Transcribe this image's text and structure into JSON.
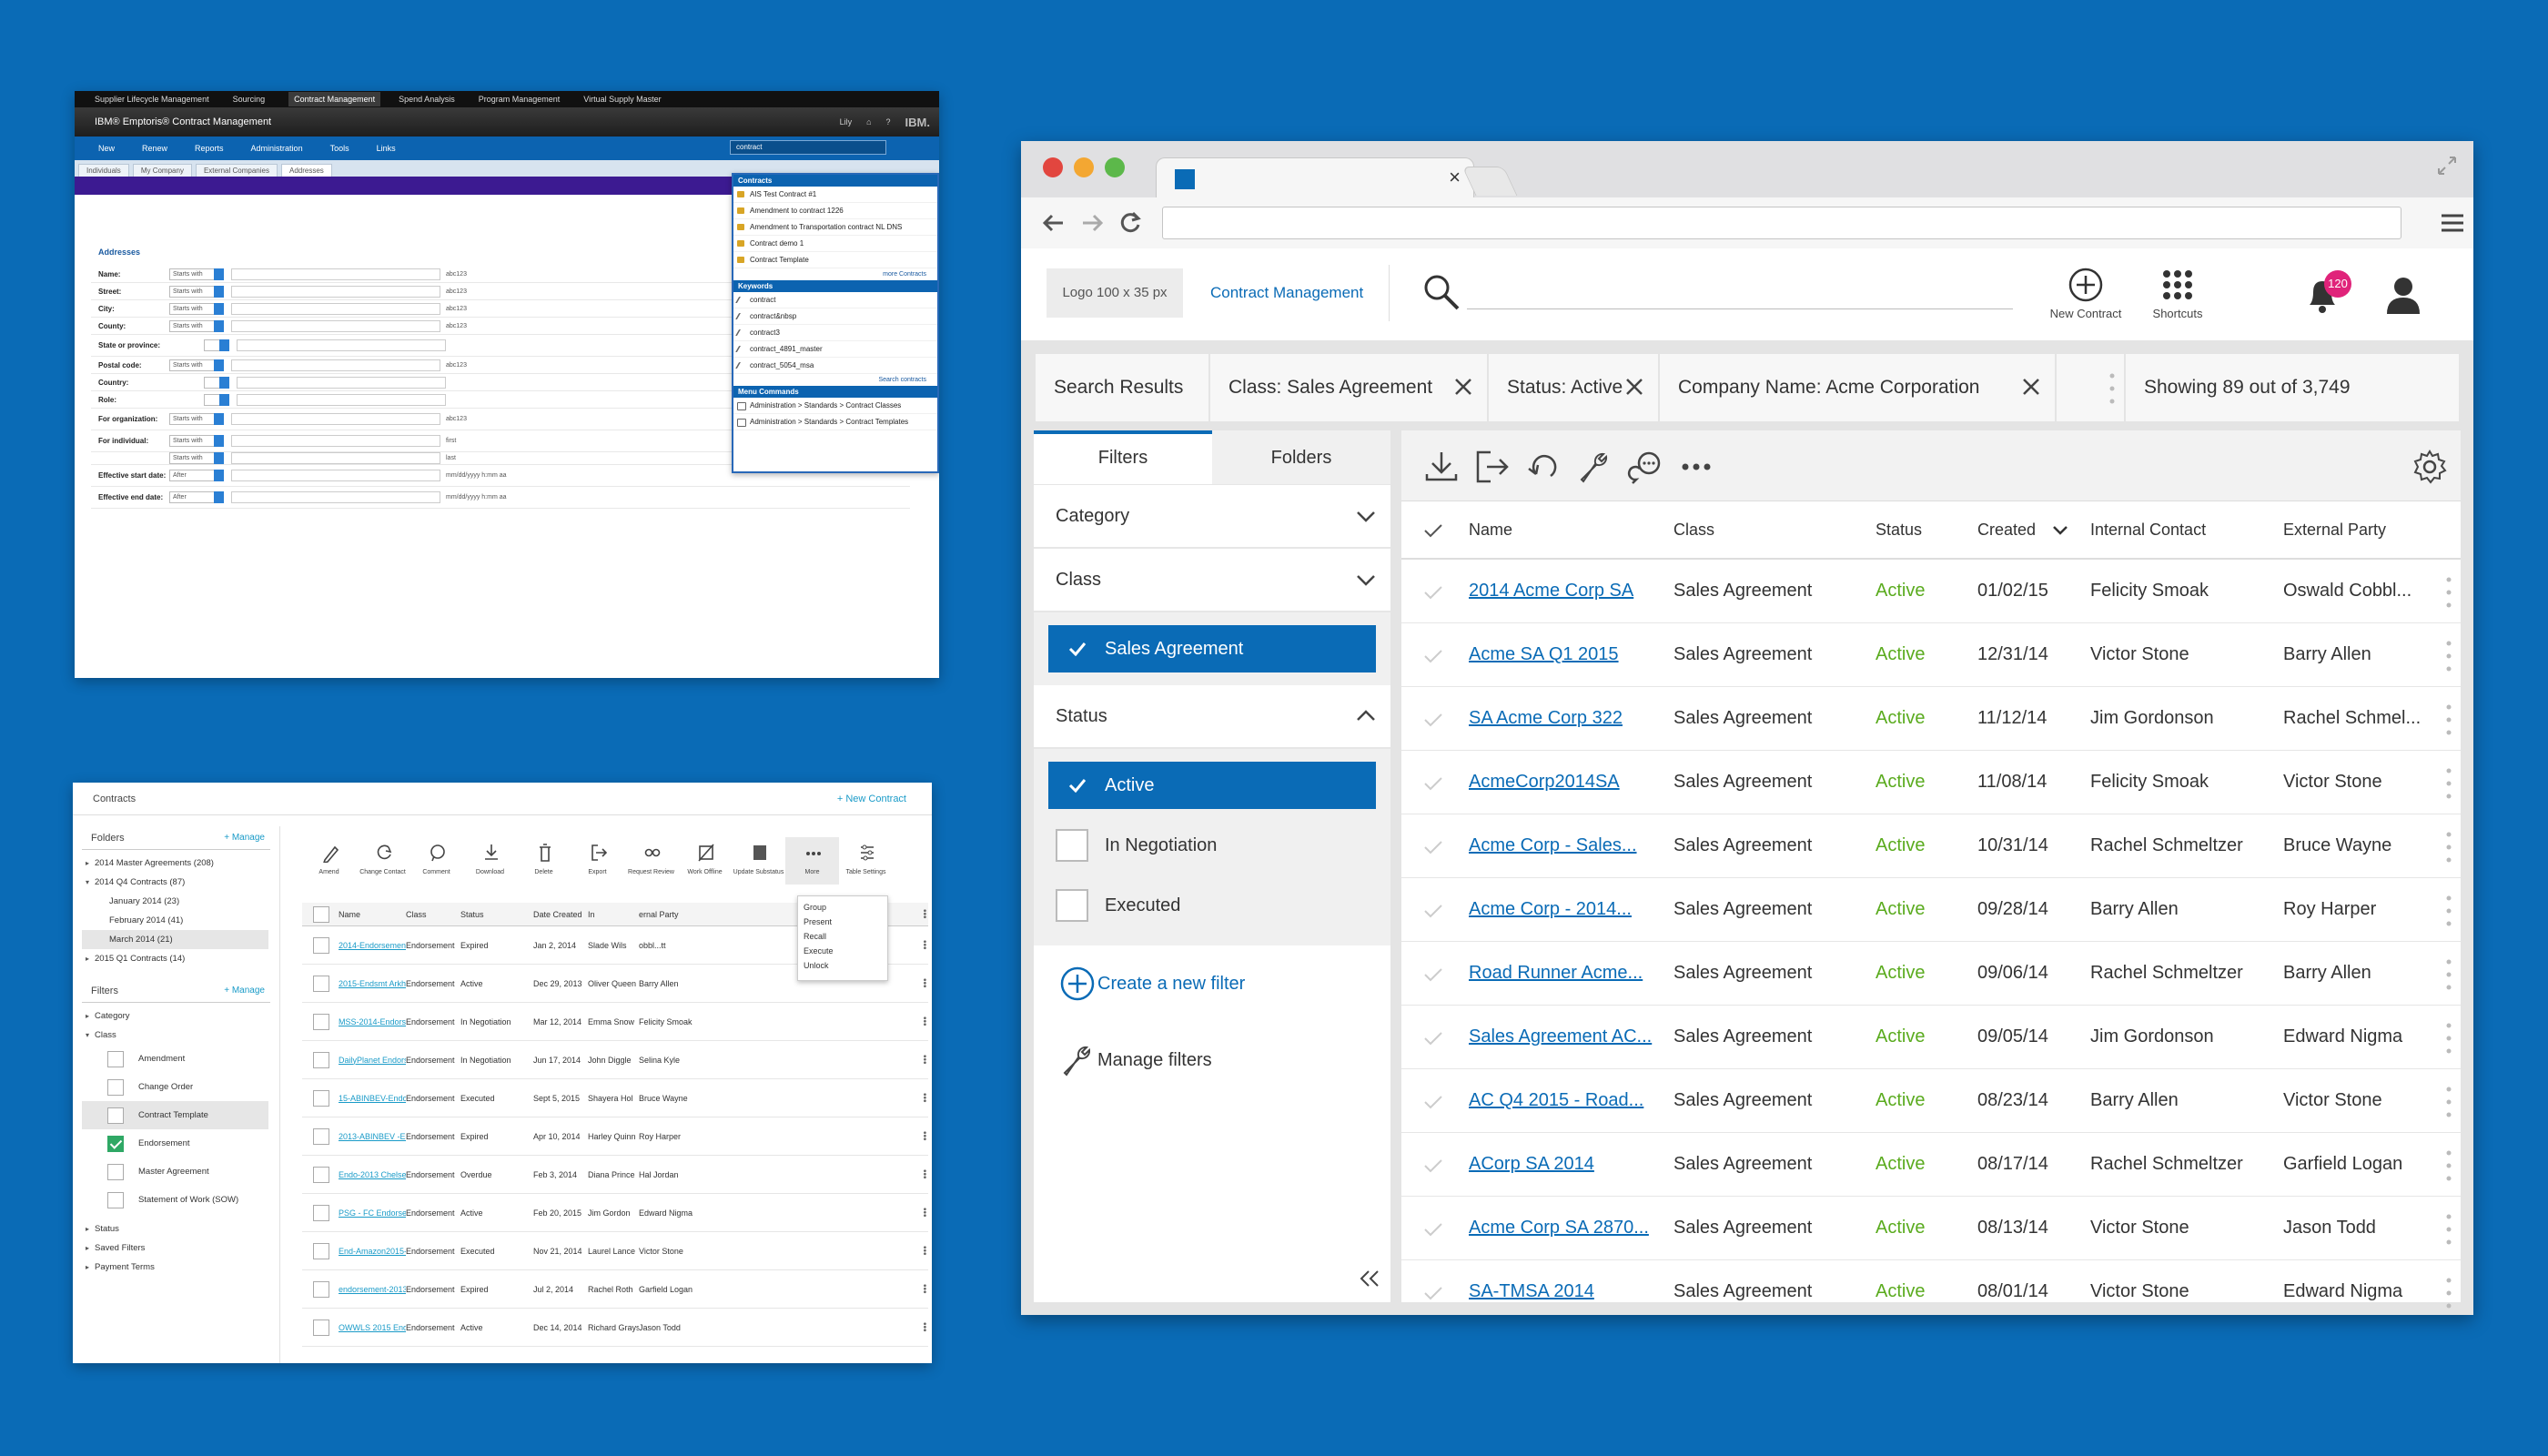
{
  "panel1": {
    "topnav": [
      "Supplier Lifecycle Management",
      "Sourcing",
      "Contract Management",
      "Spend Analysis",
      "Program Management",
      "Virtual Supply Master"
    ],
    "topnav_selected": 2,
    "app_title": "IBM® Emptoris® Contract Management",
    "user": "Lily",
    "brand": "IBM.",
    "menu": [
      "New",
      "Renew",
      "Reports",
      "Administration",
      "Tools",
      "Links"
    ],
    "search_value": "contract",
    "tabs": [
      "Individuals",
      "My Company",
      "External Companies",
      "Addresses"
    ],
    "tab_selected": 3,
    "section": "Addresses",
    "fields": [
      {
        "label": "Name:",
        "op": "Starts with",
        "hint": "abc123"
      },
      {
        "label": "Street:",
        "op": "Starts with",
        "hint": "abc123"
      },
      {
        "label": "City:",
        "op": "Starts with",
        "hint": "abc123"
      },
      {
        "label": "County:",
        "op": "Starts with",
        "hint": "abc123"
      },
      {
        "label": "State or province:",
        "op": "",
        "hint": ""
      },
      {
        "label": "Postal code:",
        "op": "Starts with",
        "hint": "abc123"
      },
      {
        "label": "Country:",
        "op": "",
        "hint": ""
      },
      {
        "label": "Role:",
        "op": "",
        "hint": ""
      },
      {
        "label": "For organization:",
        "op": "Starts with",
        "hint": "abc123"
      },
      {
        "label": "For individual:",
        "op": "Starts with",
        "hint": "first"
      },
      {
        "label": "",
        "op": "Starts with",
        "hint": "last"
      },
      {
        "label": "Effective start date:",
        "op": "After",
        "hint": "mm/dd/yyyy   h:mm aa"
      },
      {
        "label": "Effective end date:",
        "op": "After",
        "hint": "mm/dd/yyyy   h:mm aa"
      }
    ],
    "dropdown": {
      "contracts_title": "Contracts",
      "contracts": [
        "AIS Test Contract #1",
        "Amendment to contract 1226",
        "Amendment to Transportation contract NL DNS",
        "Contract demo 1",
        "Contract Template"
      ],
      "more_contracts": "more Contracts",
      "keywords_title": "Keywords",
      "keywords": [
        "contract",
        "contract&nbsp",
        "contract3",
        "contract_4891_master",
        "contract_5054_msa"
      ],
      "search_contracts": "Search contracts",
      "menu_title": "Menu Commands",
      "menu": [
        "Administration > Standards > Contract Classes",
        "Administration > Standards > Contract Templates"
      ]
    }
  },
  "panel2": {
    "title": "Contracts",
    "new_contract": "+ New Contract",
    "folders_title": "Folders",
    "manage": "+ Manage",
    "folders": [
      {
        "label": "2014 Master Agreements (208)",
        "level": 1,
        "arrow": "▸"
      },
      {
        "label": "2014 Q4 Contracts (87)",
        "level": 1,
        "arrow": "▾"
      },
      {
        "label": "January 2014 (23)",
        "level": 2,
        "arrow": ""
      },
      {
        "label": "February 2014 (41)",
        "level": 2,
        "arrow": ""
      },
      {
        "label": "March 2014 (21)",
        "level": 2,
        "arrow": "",
        "hl": true
      },
      {
        "label": "2015 Q1 Contracts (14)",
        "level": 1,
        "arrow": "▸"
      }
    ],
    "filters_title": "Filters",
    "category": "Category",
    "class": "Class",
    "classes": [
      {
        "label": "Amendment",
        "on": false
      },
      {
        "label": "Change Order",
        "on": false
      },
      {
        "label": "Contract Template",
        "on": false,
        "hl": true
      },
      {
        "label": "Endorsement",
        "on": true
      },
      {
        "label": "Master Agreement",
        "on": false
      },
      {
        "label": "Statement of Work (SOW)",
        "on": false
      }
    ],
    "bottom": [
      "Status",
      "Saved Filters",
      "Payment Terms"
    ],
    "toolbar": [
      "Amend",
      "Change Contact",
      "Comment",
      "Download",
      "Delete",
      "Export",
      "Request Review",
      "Work Offline",
      "Update Substatus",
      "More",
      "Table Settings"
    ],
    "more_menu": [
      "Group",
      "Present",
      "Recall",
      "Execute",
      "Unlock"
    ],
    "columns": [
      "Name",
      "Class",
      "Status",
      "Date Created",
      "In",
      "ernal Party"
    ],
    "rows": [
      [
        "2014-EndorsementPS...",
        "Endorsement",
        "Expired",
        "Jan 2, 2014",
        "Slade Wils",
        "obbl...tt"
      ],
      [
        "2015-Endsmt Arkham",
        "Endorsement",
        "Active",
        "Dec 29, 2013",
        "Oliver Queen",
        "Barry Allen"
      ],
      [
        "MSS-2014-Endorseme...",
        "Endorsement",
        "In Negotiation",
        "Mar 12, 2014",
        "Emma Snow",
        "Felicity Smoak"
      ],
      [
        "DailyPlanet Endorsem...",
        "Endorsement",
        "In Negotiation",
        "Jun 17, 2014",
        "John Diggle",
        "Selina Kyle"
      ],
      [
        "15-ABINBEV-Endo...",
        "Endorsement",
        "Executed",
        "Sept 5, 2015",
        "Shayera Hol",
        "Bruce Wayne"
      ],
      [
        "2013-ABINBEV -Endo...",
        "Endorsement",
        "Expired",
        "Apr 10, 2014",
        "Harley Quinn",
        "Roy Harper"
      ],
      [
        "Endo-2013 Chelsea R...",
        "Endorsement",
        "Overdue",
        "Feb 3, 2014",
        "Diana Prince",
        "Hal Jordan"
      ],
      [
        "PSG - FC Endorsement...",
        "Endorsement",
        "Active",
        "Feb 20, 2015",
        "Jim Gordon",
        "Edward Nigma"
      ],
      [
        "End-Amazon2015-R...",
        "Endorsement",
        "Executed",
        "Nov 21, 2014",
        "Laurel Lance",
        "Victor Stone"
      ],
      [
        "endorsement-2013 RTC",
        "Endorsement",
        "Expired",
        "Jul 2, 2014",
        "Rachel Roth",
        "Garfield Logan"
      ],
      [
        "OWWLS 2015 End...",
        "Endorsement",
        "Active",
        "Dec 14, 2014",
        "Richard Grayson",
        "Jason Todd"
      ]
    ]
  },
  "panel3": {
    "logo": "Logo 100 x 35 px",
    "app_link": "Contract Management",
    "new_contract": "New Contract",
    "shortcuts": "Shortcuts",
    "notifications": "120",
    "chips": [
      {
        "label": "Search Results",
        "close": false
      },
      {
        "label": "Class: Sales Agreement",
        "close": true
      },
      {
        "label": "Status: Active",
        "close": true
      },
      {
        "label": "Company Name: Acme Corporation",
        "close": true
      },
      {
        "label": "",
        "close": false,
        "more": true
      },
      {
        "label": "Showing 89 out of 3,749",
        "close": false
      }
    ],
    "tabs": [
      "Filters",
      "Folders"
    ],
    "category": "Category",
    "class": "Class",
    "class_selected": "Sales Agreement",
    "status": "Status",
    "status_options": [
      {
        "label": "Active",
        "on": true
      },
      {
        "label": "In Negotiation",
        "on": false
      },
      {
        "label": "Executed",
        "on": false
      }
    ],
    "create_filter": "Create a new filter",
    "manage_filters": "Manage filters",
    "columns": [
      "Name",
      "Class",
      "Status",
      "Created",
      "Internal Contact",
      "External Party"
    ],
    "rows": [
      [
        "2014 Acme Corp SA",
        "Sales Agreement",
        "Active",
        "01/02/15",
        "Felicity Smoak",
        "Oswald Cobbl..."
      ],
      [
        "Acme SA Q1 2015",
        "Sales Agreement",
        "Active",
        "12/31/14",
        "Victor Stone",
        "Barry Allen"
      ],
      [
        "SA Acme Corp 322",
        "Sales Agreement",
        "Active",
        "11/12/14",
        "Jim Gordonson",
        "Rachel Schmel..."
      ],
      [
        "AcmeCorp2014SA",
        "Sales Agreement",
        "Active",
        "11/08/14",
        "Felicity Smoak",
        "Victor Stone"
      ],
      [
        "Acme Corp - Sales...",
        "Sales Agreement",
        "Active",
        "10/31/14",
        "Rachel Schmeltzer",
        "Bruce Wayne"
      ],
      [
        "Acme Corp - 2014...",
        "Sales Agreement",
        "Active",
        "09/28/14",
        "Barry Allen",
        "Roy Harper"
      ],
      [
        "Road Runner Acme...",
        "Sales Agreement",
        "Active",
        "09/06/14",
        "Rachel Schmeltzer",
        "Barry Allen"
      ],
      [
        "Sales Agreement AC...",
        "Sales Agreement",
        "Active",
        "09/05/14",
        "Jim Gordonson",
        "Edward Nigma"
      ],
      [
        "AC Q4 2015 - Road...",
        "Sales Agreement",
        "Active",
        "08/23/14",
        "Barry Allen",
        "Victor Stone"
      ],
      [
        "ACorp SA 2014",
        "Sales Agreement",
        "Active",
        "08/17/14",
        "Rachel Schmeltzer",
        "Garfield Logan"
      ],
      [
        "Acme Corp SA 2870...",
        "Sales Agreement",
        "Active",
        "08/13/14",
        "Victor Stone",
        "Jason Todd"
      ],
      [
        "SA-TMSA 2014",
        "Sales Agreement",
        "Active",
        "08/01/14",
        "Victor Stone",
        "Edward Nigma"
      ]
    ]
  },
  "colors": {
    "background": "#0a6bb6",
    "accent": "#0a6bb6",
    "active": "#5aab1e",
    "badge": "#e0237a",
    "teal_link": "#1a9bc8"
  }
}
